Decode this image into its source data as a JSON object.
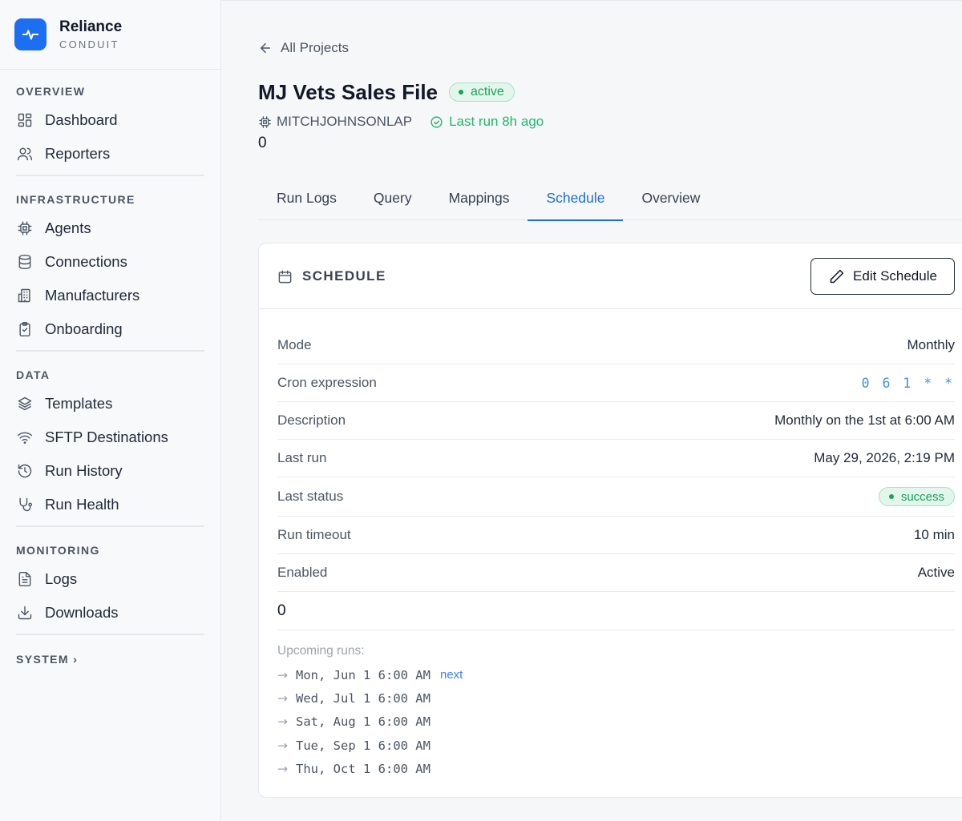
{
  "brand": {
    "name": "Reliance",
    "subtitle": "CONDUIT"
  },
  "sidebar": {
    "overview": {
      "heading": "OVERVIEW",
      "items": [
        {
          "label": "Dashboard"
        },
        {
          "label": "Reporters"
        }
      ]
    },
    "infrastructure": {
      "heading": "INFRASTRUCTURE",
      "items": [
        {
          "label": "Agents"
        },
        {
          "label": "Connections"
        },
        {
          "label": "Manufacturers"
        },
        {
          "label": "Onboarding"
        }
      ]
    },
    "data": {
      "heading": "DATA",
      "items": [
        {
          "label": "Templates"
        },
        {
          "label": "SFTP Destinations"
        },
        {
          "label": "Run History"
        },
        {
          "label": "Run Health"
        }
      ]
    },
    "monitoring": {
      "heading": "MONITORING",
      "items": [
        {
          "label": "Logs"
        },
        {
          "label": "Downloads"
        }
      ]
    },
    "system": {
      "heading": "SYSTEM ›"
    }
  },
  "header": {
    "back_label": "All Projects",
    "title": "MJ Vets Sales File",
    "status": "active",
    "agent": "MITCHJOHNSONLAP",
    "last_run": "Last run 8h ago",
    "stray_value": "0"
  },
  "tabs": [
    {
      "label": "Run Logs"
    },
    {
      "label": "Query"
    },
    {
      "label": "Mappings"
    },
    {
      "label": "Schedule"
    },
    {
      "label": "Overview"
    }
  ],
  "schedule": {
    "title": "SCHEDULE",
    "edit_label": "Edit Schedule",
    "rows": [
      {
        "key": "Mode",
        "value": "Monthly"
      },
      {
        "key": "Cron expression",
        "value": "0 6 1 * *"
      },
      {
        "key": "Description",
        "value": "Monthly on the 1st at 6:00 AM"
      },
      {
        "key": "Last run",
        "value": "May 29, 2026, 2:19 PM"
      },
      {
        "key": "Last status",
        "value": "success"
      },
      {
        "key": "Run timeout",
        "value": "10 min"
      },
      {
        "key": "Enabled",
        "value": "Active"
      }
    ],
    "stray_value": "0",
    "upcoming_label": "Upcoming runs:",
    "upcoming_runs": [
      "Mon, Jun 1 6:00 AM",
      "Wed, Jul 1 6:00 AM",
      "Sat, Aug 1 6:00 AM",
      "Tue, Sep 1 6:00 AM",
      "Thu, Oct 1 6:00 AM"
    ],
    "next_tag": "next"
  },
  "colors": {
    "accent": "#1d6ff2",
    "active_tab": "#1d6fd8",
    "success": "#16a35c"
  }
}
